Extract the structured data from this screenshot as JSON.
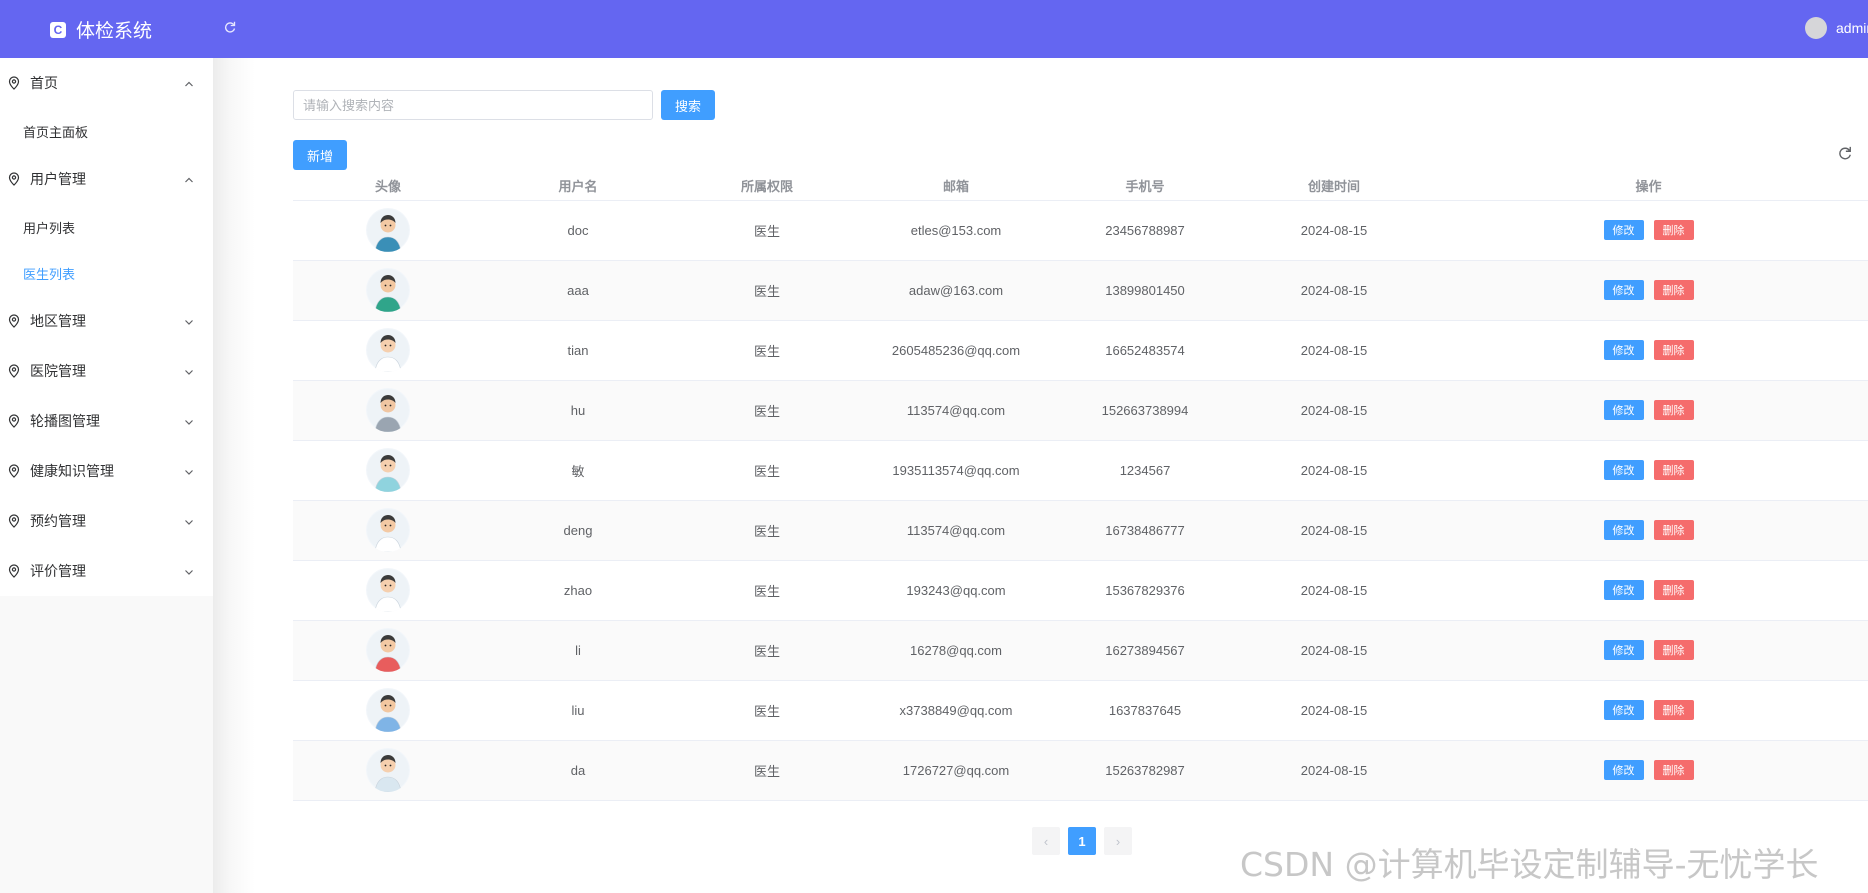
{
  "header": {
    "brand_title": "体检系统",
    "user_name": "admin",
    "accent_color": "#6466f1"
  },
  "sidebar": {
    "groups": [
      {
        "label": "首页",
        "expanded": true,
        "items": [
          {
            "label": "首页主面板",
            "active": false
          }
        ]
      },
      {
        "label": "用户管理",
        "expanded": true,
        "items": [
          {
            "label": "用户列表",
            "active": false
          },
          {
            "label": "医生列表",
            "active": true
          }
        ]
      },
      {
        "label": "地区管理",
        "expanded": false,
        "items": []
      },
      {
        "label": "医院管理",
        "expanded": false,
        "items": []
      },
      {
        "label": "轮播图管理",
        "expanded": false,
        "items": []
      },
      {
        "label": "健康知识管理",
        "expanded": false,
        "items": []
      },
      {
        "label": "预约管理",
        "expanded": false,
        "items": []
      },
      {
        "label": "评价管理",
        "expanded": false,
        "items": []
      }
    ]
  },
  "search": {
    "placeholder": "请输入搜索内容",
    "value": "",
    "button_label": "搜索"
  },
  "toolbar": {
    "add_label": "新增"
  },
  "table": {
    "columns": [
      "头像",
      "用户名",
      "所属权限",
      "邮箱",
      "手机号",
      "创建时间",
      "操作"
    ],
    "edit_label": "修改",
    "delete_label": "删除",
    "rows": [
      {
        "username": "doc",
        "role": "医生",
        "email": "etles@153.com",
        "phone": "23456788987",
        "created": "2024-08-15",
        "avatar_icon": "doctor-avatar-icon"
      },
      {
        "username": "aaa",
        "role": "医生",
        "email": "adaw@163.com",
        "phone": "13899801450",
        "created": "2024-08-15",
        "avatar_icon": "doctor-avatar-icon"
      },
      {
        "username": "tian",
        "role": "医生",
        "email": "2605485236@qq.com",
        "phone": "16652483574",
        "created": "2024-08-15",
        "avatar_icon": "doctor-avatar-icon"
      },
      {
        "username": "hu",
        "role": "医生",
        "email": "113574@qq.com",
        "phone": "152663738994",
        "created": "2024-08-15",
        "avatar_icon": "doctor-avatar-icon"
      },
      {
        "username": "敏",
        "role": "医生",
        "email": "1935113574@qq.com",
        "phone": "1234567",
        "created": "2024-08-15",
        "avatar_icon": "doctor-avatar-icon"
      },
      {
        "username": "deng",
        "role": "医生",
        "email": "113574@qq.com",
        "phone": "16738486777",
        "created": "2024-08-15",
        "avatar_icon": "doctor-avatar-icon"
      },
      {
        "username": "zhao",
        "role": "医生",
        "email": "193243@qq.com",
        "phone": "15367829376",
        "created": "2024-08-15",
        "avatar_icon": "doctor-avatar-icon"
      },
      {
        "username": "li",
        "role": "医生",
        "email": "16278@qq.com",
        "phone": "16273894567",
        "created": "2024-08-15",
        "avatar_icon": "doctor-avatar-icon"
      },
      {
        "username": "liu",
        "role": "医生",
        "email": "x3738849@qq.com",
        "phone": "1637837645",
        "created": "2024-08-15",
        "avatar_icon": "doctor-avatar-icon"
      },
      {
        "username": "da",
        "role": "医生",
        "email": "1726727@qq.com",
        "phone": "15263782987",
        "created": "2024-08-15",
        "avatar_icon": "doctor-avatar-icon"
      }
    ]
  },
  "pagination": {
    "current_page": "1",
    "prev_icon": "chevron-left-icon",
    "next_icon": "chevron-right-icon"
  },
  "watermark": "CSDN @计算机毕设定制辅导-无忧学长"
}
